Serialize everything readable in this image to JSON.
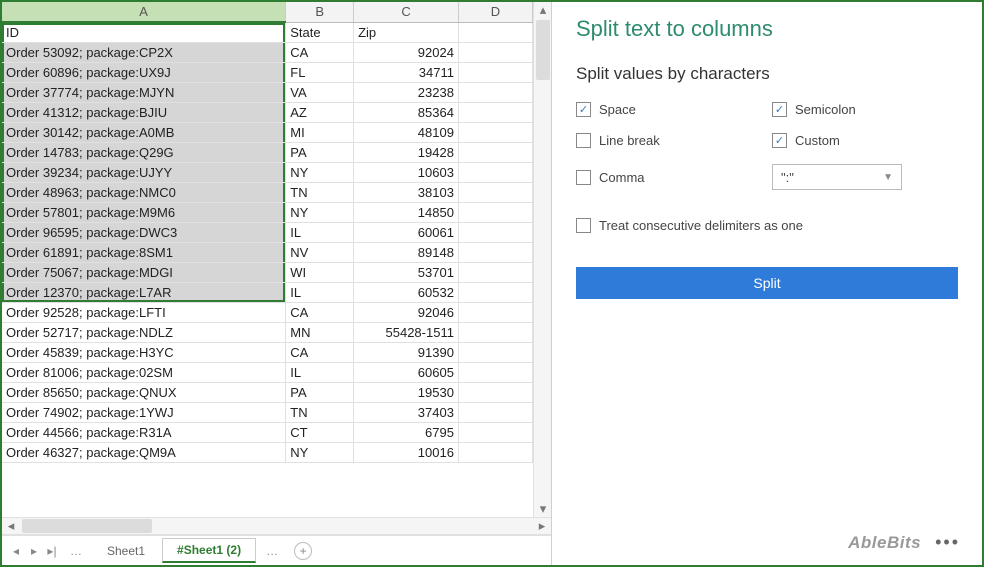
{
  "columns": [
    "A",
    "B",
    "C",
    "D"
  ],
  "header_row": {
    "id": "ID",
    "state": "State",
    "zip": "Zip"
  },
  "rows": [
    {
      "id": "Order 53092; package:CP2X",
      "state": "CA",
      "zip": "92024",
      "sel": true
    },
    {
      "id": "Order 60896; package:UX9J",
      "state": "FL",
      "zip": "34711",
      "sel": true
    },
    {
      "id": "Order 37774; package:MJYN",
      "state": "VA",
      "zip": "23238",
      "sel": true
    },
    {
      "id": "Order 41312; package:BJIU",
      "state": "AZ",
      "zip": "85364",
      "sel": true
    },
    {
      "id": "Order 30142; package:A0MB",
      "state": "MI",
      "zip": "48109",
      "sel": true
    },
    {
      "id": "Order 14783; package:Q29G",
      "state": "PA",
      "zip": "19428",
      "sel": true
    },
    {
      "id": "Order 39234; package:UJYY",
      "state": "NY",
      "zip": "10603",
      "sel": true
    },
    {
      "id": "Order 48963; package:NMC0",
      "state": "TN",
      "zip": "38103",
      "sel": true
    },
    {
      "id": "Order 57801; package:M9M6",
      "state": "NY",
      "zip": "14850",
      "sel": true
    },
    {
      "id": "Order 96595; package:DWC3",
      "state": "IL",
      "zip": "60061",
      "sel": true
    },
    {
      "id": "Order 61891; package:8SM1",
      "state": "NV",
      "zip": "89148",
      "sel": true
    },
    {
      "id": "Order 75067; package:MDGI",
      "state": "WI",
      "zip": "53701",
      "sel": true
    },
    {
      "id": "Order 12370; package:L7AR",
      "state": "IL",
      "zip": "60532",
      "sel": true
    },
    {
      "id": "Order 92528; package:LFTI",
      "state": "CA",
      "zip": "92046",
      "sel": false
    },
    {
      "id": "Order 52717; package:NDLZ",
      "state": "MN",
      "zip": "55428-1511",
      "sel": false
    },
    {
      "id": "Order 45839; package:H3YC",
      "state": "CA",
      "zip": "91390",
      "sel": false
    },
    {
      "id": "Order 81006; package:02SM",
      "state": "IL",
      "zip": "60605",
      "sel": false
    },
    {
      "id": "Order 85650; package:QNUX",
      "state": "PA",
      "zip": "19530",
      "sel": false
    },
    {
      "id": "Order 74902; package:1YWJ",
      "state": "TN",
      "zip": "37403",
      "sel": false
    },
    {
      "id": "Order 44566; package:R31A",
      "state": "CT",
      "zip": "6795",
      "sel": false
    },
    {
      "id": "Order 46327; package:QM9A",
      "state": "NY",
      "zip": "10016",
      "sel": false
    }
  ],
  "tabs": {
    "sheet1": "Sheet1",
    "sheet1_2": "#Sheet1 (2)"
  },
  "panel": {
    "title": "Split text to columns",
    "subtitle": "Split values by characters",
    "checks": {
      "space": "Space",
      "semicolon": "Semicolon",
      "linebreak": "Line break",
      "custom": "Custom",
      "comma": "Comma"
    },
    "custom_value": "\":\"",
    "treat": "Treat consecutive delimiters as one",
    "split_btn": "Split"
  },
  "brand": "AbleBits"
}
